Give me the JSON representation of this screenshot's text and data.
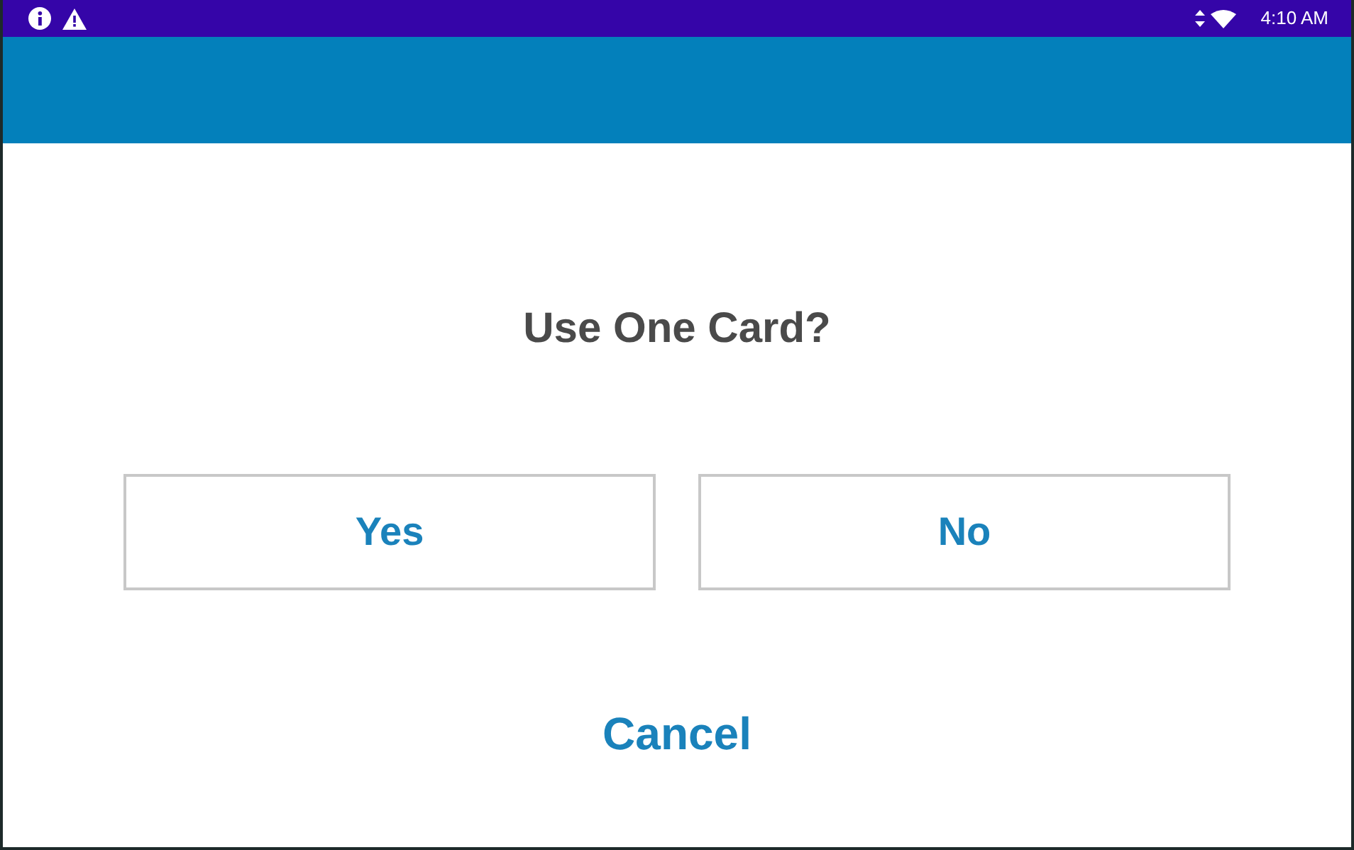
{
  "status_bar": {
    "time": "4:10 AM"
  },
  "dialog": {
    "question": "Use One Card?",
    "buttons": [
      {
        "label": "Yes"
      },
      {
        "label": "No"
      }
    ],
    "cancel": "Cancel"
  }
}
